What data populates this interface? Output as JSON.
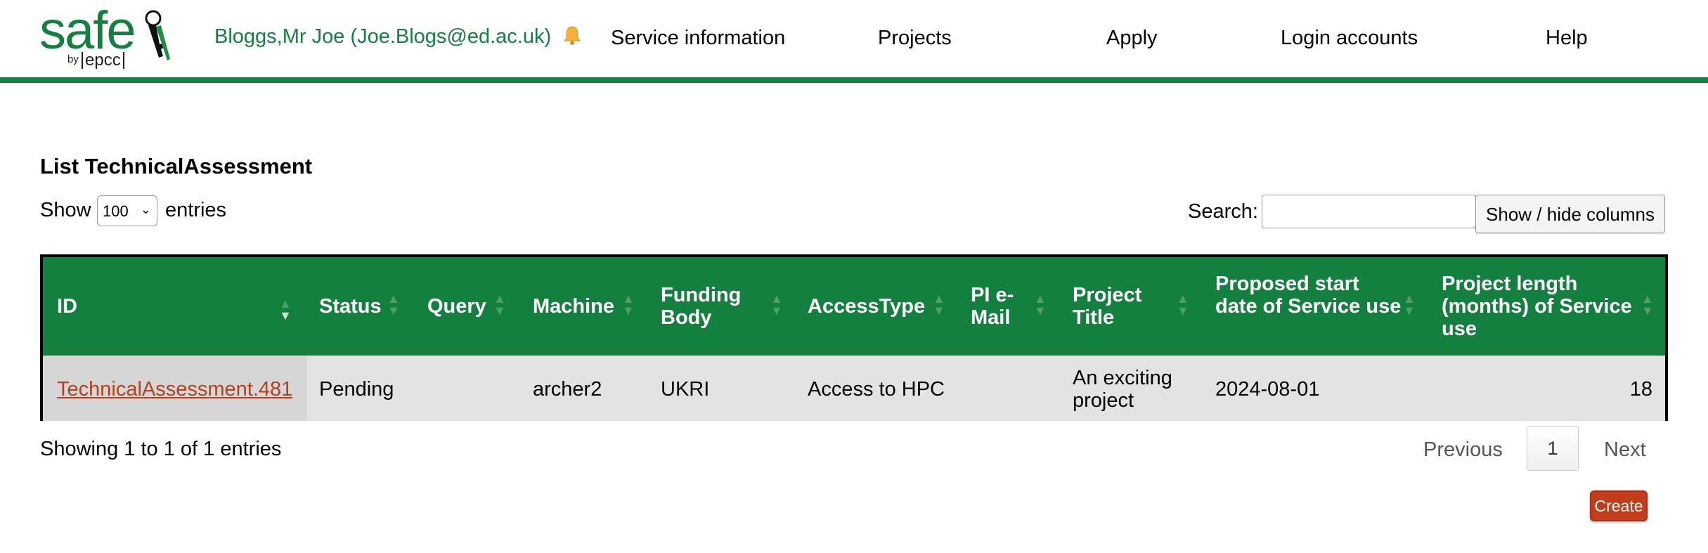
{
  "brand": {
    "logo_text": "safe",
    "by": "by",
    "org": "epcc"
  },
  "header": {
    "user": "Bloggs,Mr Joe (Joe.Blogs@ed.ac.uk)",
    "nav": [
      "Service information",
      "Projects",
      "Apply",
      "Login accounts",
      "Help"
    ]
  },
  "page": {
    "title": "List TechnicalAssessment"
  },
  "controls": {
    "show_label": "Show",
    "entries_value": "100",
    "entries_label": "entries",
    "search_label": "Search:",
    "search_value": "",
    "columns_button": "Show / hide columns"
  },
  "table": {
    "columns": [
      {
        "label": "ID"
      },
      {
        "label": "Status"
      },
      {
        "label": "Query"
      },
      {
        "label": "Machine"
      },
      {
        "label": "Funding Body"
      },
      {
        "label": "AccessType"
      },
      {
        "label": "PI e-Mail"
      },
      {
        "label": "Project Title"
      },
      {
        "label": "Proposed start date of Service use"
      },
      {
        "label": "Project length (months) of Service use"
      }
    ],
    "rows": [
      {
        "id": "TechnicalAssessment.481",
        "status": "Pending",
        "query": "",
        "machine": "archer2",
        "funding_body": "UKRI",
        "access_type": "Access to HPC",
        "pi_email": "",
        "project_title": "An exciting project",
        "start_date": "2024-08-01",
        "length_months": "18"
      }
    ]
  },
  "footer": {
    "info": "Showing 1 to 1 of 1 entries",
    "prev": "Previous",
    "page": "1",
    "next": "Next",
    "create": "Create"
  },
  "colors": {
    "brand_green": "#138040",
    "link": "#b5401c",
    "create_button": "#c23e1a",
    "row_bg": "#e3e3e3"
  }
}
